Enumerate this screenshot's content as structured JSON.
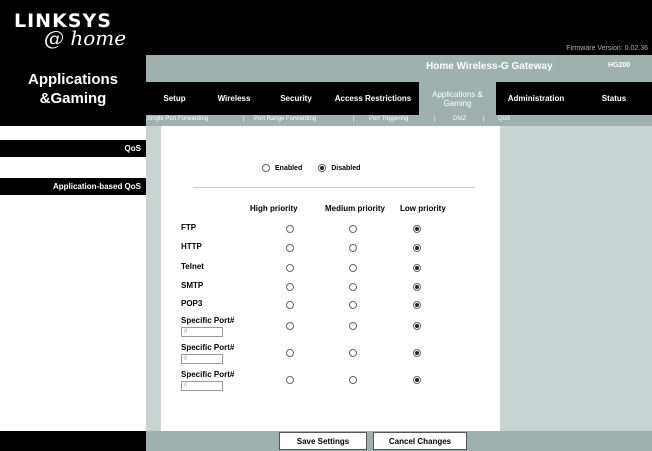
{
  "header": {
    "brand": "LINKSYS",
    "tagline": "@ home",
    "firmware": "Firmware Version: 0.02.36",
    "product_name": "Home Wireless-G Gateway",
    "model": "HG200"
  },
  "page_title": "Applications &Gaming",
  "tabs": [
    {
      "label": "Setup"
    },
    {
      "label": "Wireless"
    },
    {
      "label": "Security"
    },
    {
      "label": "Access Restrictions"
    },
    {
      "label": "Applications & Gaming"
    },
    {
      "label": "Administration"
    },
    {
      "label": "Status"
    }
  ],
  "subnav": [
    {
      "label": "Single Port Forwarding"
    },
    {
      "label": "Port Range Forwarding"
    },
    {
      "label": "Port Triggering"
    },
    {
      "label": "DMZ"
    },
    {
      "label": "QoS"
    }
  ],
  "subnav_sep": "|",
  "sections": {
    "qos": "QoS",
    "app_qos": "Application-based QoS"
  },
  "qos_toggle": {
    "enabled_label": "Enabled",
    "disabled_label": "Disabled",
    "selected": "Disabled"
  },
  "priority_headers": [
    "High priority",
    "Medium priority",
    "Low priority"
  ],
  "applications": [
    {
      "name": "FTP",
      "priority": "Low"
    },
    {
      "name": "HTTP",
      "priority": "Low"
    },
    {
      "name": "Telnet",
      "priority": "Low"
    },
    {
      "name": "SMTP",
      "priority": "Low"
    },
    {
      "name": "POP3",
      "priority": "Low"
    },
    {
      "name": "Specific Port#",
      "port": "0",
      "priority": "Low"
    },
    {
      "name": "Specific Port#",
      "port": "0",
      "priority": "Low"
    },
    {
      "name": "Specific Port#",
      "port": "0",
      "priority": "Low"
    }
  ],
  "buttons": {
    "save": "Save Settings",
    "cancel": "Cancel Changes"
  },
  "colors": {
    "accent": "#9fb0ae",
    "panel": "#c9d4d2"
  }
}
